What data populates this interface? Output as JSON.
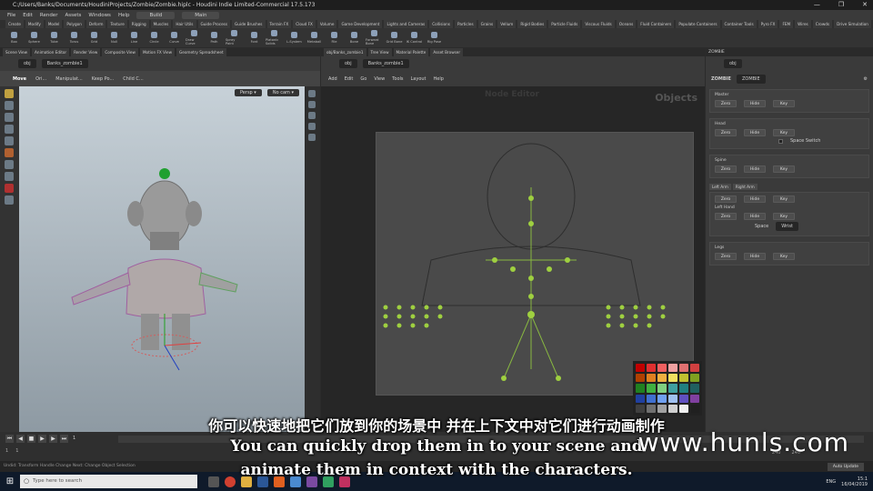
{
  "window": {
    "title": "C:/Users/Banks/Documents/HoudiniProjects/Zombie/Zombie.hiplc - Houdini Indie Limited-Commercial 17.5.173",
    "controls": [
      "—",
      "❐",
      "✕"
    ]
  },
  "menubar": {
    "items": [
      "File",
      "Edit",
      "Render",
      "Assets",
      "Windows",
      "Help"
    ],
    "build": "Build",
    "desktop": "Main"
  },
  "shelf_tabs": [
    "Create",
    "Modify",
    "Model",
    "Polygon",
    "Deform",
    "Texture",
    "Rigging",
    "Muscles",
    "Hair Utils",
    "Guide Process",
    "Guide Brushes",
    "Terrain FX",
    "Cloud FX",
    "Volume",
    "Game Development",
    "Lights and Cameras",
    "Collisions",
    "Particles",
    "Grains",
    "Vellum",
    "Rigid Bodies",
    "Particle Fluids",
    "Viscous Fluids",
    "Oceans",
    "Fluid Containers",
    "Populate Containers",
    "Container Tools",
    "Pyro FX",
    "FEM",
    "Wires",
    "Crowds",
    "Drive Simulation",
    "Rig Tools",
    "New Rig"
  ],
  "shelf_tools": [
    "Box",
    "Sphere",
    "Tube",
    "Torus",
    "Grid",
    "Null",
    "Line",
    "Circle",
    "Curve",
    "Draw Curve",
    "Path",
    "Spray Paint",
    "Font",
    "Platonic Solids",
    "L-System",
    "Metaball",
    "File",
    "Bone",
    "Forward Bone",
    "Grid Bone",
    "IK Control",
    "Rig Pose"
  ],
  "left_pane": {
    "tabs": [
      "Scene View",
      "Animation Editor",
      "Render View",
      "Composite View",
      "Motion FX View",
      "Geometry Spreadsheet"
    ],
    "path_context": "obj",
    "path_node": "Banks_zombie1",
    "tool_label": "Move",
    "tool_options": [
      "Ori...",
      "Manipulat...",
      "Keep Po...",
      "Child C..."
    ],
    "view_persp": "Persp ▾",
    "view_cam": "No cam ▾"
  },
  "network_editor": {
    "tabs": [
      "obj/Banks_zombie1",
      "Tree View",
      "Material Palette",
      "Asset Browser"
    ],
    "path_context": "obj",
    "path_node": "Banks_zombie1",
    "menu": [
      "Add",
      "Edit",
      "Go",
      "View",
      "Tools",
      "Layout",
      "Help"
    ],
    "ghost_title": "Node Editor",
    "context_label": "Objects"
  },
  "palette_colors": [
    "#c00000",
    "#e03030",
    "#f06060",
    "#f0a0a0",
    "#e07070",
    "#d04040",
    "#b04000",
    "#e08020",
    "#f0b040",
    "#f0e060",
    "#c0c030",
    "#80a020",
    "#208020",
    "#40b040",
    "#80d080",
    "#40a0a0",
    "#208080",
    "#206060",
    "#2040a0",
    "#4070d0",
    "#70a0f0",
    "#a0c0f0",
    "#6050c0",
    "#8040a0",
    "#404040",
    "#707070",
    "#a0a0a0",
    "#d0d0d0",
    "#f0f0f0",
    "#202020"
  ],
  "params": {
    "tab": "ZOMBIE",
    "path_context": "obj",
    "node_type": "ZOMBIE",
    "node_name": "ZOMBIE",
    "sections": {
      "master": "Master",
      "head": "Head",
      "spine": "Spine",
      "arm_tabs": [
        "Left Arm",
        "Right Arm"
      ],
      "left_hand": "Left Hand",
      "legs": "Legs"
    },
    "btn_zero": "Zero",
    "btn_hide": "Hide",
    "btn_key": "Key",
    "space_switch": "Space Switch",
    "space_label": "Space",
    "space_value": "Wrist"
  },
  "timeline": {
    "frame": "1",
    "start": "1",
    "end": "1",
    "range_start": "240",
    "range_end": "240"
  },
  "status": {
    "text": "Undid: Transform Handle Change  Next: Change Object Selection",
    "auto_update": "Auto Update"
  },
  "taskbar": {
    "search_placeholder": "Type here to search",
    "lang": "ENG",
    "time": "15:1",
    "date": "16/04/2019"
  },
  "subtitles": {
    "cn": "你可以快速地把它们放到你的场景中 并在上下文中对它们进行动画制作",
    "en1": "You can quickly drop them in to your scene and",
    "en2": "animate them in context with the characters."
  },
  "watermark": "www.hunls.com"
}
